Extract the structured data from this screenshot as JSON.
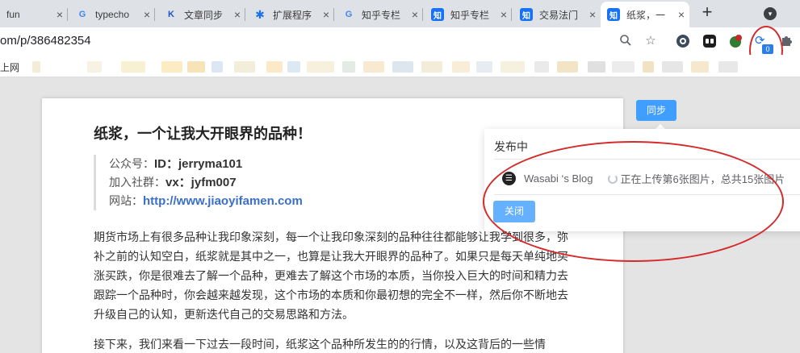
{
  "tabs": [
    {
      "title": "fun",
      "icon": "blank-page-icon"
    },
    {
      "title": "typecho",
      "icon": "google-icon"
    },
    {
      "title": "文章同步",
      "icon": "k-icon"
    },
    {
      "title": "扩展程序",
      "icon": "puzzle-icon"
    },
    {
      "title": "知乎专栏",
      "icon": "google-icon"
    },
    {
      "title": "知乎专栏",
      "icon": "zhihu-icon"
    },
    {
      "title": "交易法门",
      "icon": "zhihu-icon"
    },
    {
      "title": "纸浆，一",
      "icon": "zhihu-icon",
      "active": true
    }
  ],
  "favicon_text": {
    "google": "G",
    "zhihu": "知",
    "k": "K",
    "puzzle": "✱"
  },
  "tab_close_glyph": "×",
  "new_tab_glyph": "+",
  "address": {
    "url": "om/p/386482354"
  },
  "extension_badge": "0",
  "bookmarks": {
    "first_label": "上网"
  },
  "article": {
    "title": "纸浆，一个让我大开眼界的品种！",
    "quote": {
      "line1_label": "公众号：",
      "line1_value": "ID：jerryma101",
      "line2_label": "加入社群：",
      "line2_value": "vx：jyfm007",
      "line3_label": "网站：",
      "line3_link": "http://www.jiaoyifamen.com"
    },
    "paragraph1": "期货市场上有很多品种让我印象深刻，每一个让我印象深刻的品种往往都能够让我学到很多，弥补之前的认知空白，纸浆就是其中之一，也算是让我大开眼界的品种了。如果只是每天单纯地买涨买跌，你是很难去了解一个品种，更难去了解这个市场的本质，当你投入巨大的时间和精力去跟踪一个品种时，你会越来越发现，这个市场的本质和你最初想的完全不一样，然后你不断地去升级自己的认知，更新迭代自己的交易思路和方法。",
    "paragraph2": "接下来，我们来看一下过去一段时间，纸浆这个品种所发生的的行情，以及这背后的一些情"
  },
  "sync_button": "同步",
  "popup": {
    "title": "发布中",
    "blog_name": "Wasabi ‘s Blog",
    "blog_icon_glyph": "☰",
    "status": "正在上传第6张图片，总共15张图片",
    "close_button": "关闭"
  },
  "colors": {
    "accent": "#409eff",
    "annotation_red": "#d42a2a",
    "zhihu_blue": "#1772f6"
  }
}
